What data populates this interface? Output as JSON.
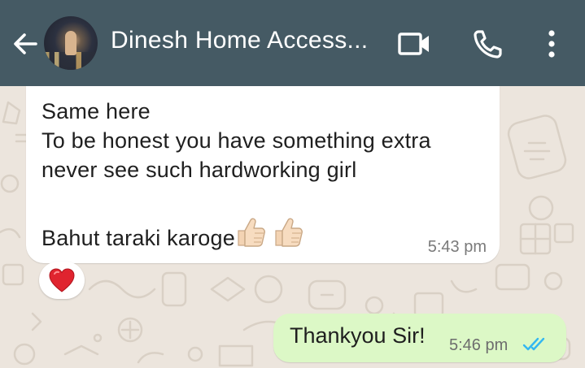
{
  "header": {
    "contact_name": "Dinesh Home Access...",
    "background_color": "#455a64",
    "icons": [
      "back-arrow-icon",
      "video-call-icon",
      "phone-icon",
      "more-vert-icon"
    ]
  },
  "messages": [
    {
      "direction": "incoming",
      "lines": [
        "Same here",
        "To be honest you have something extra",
        "never see such hardworking girl",
        "",
        "Bahut taraki karoge"
      ],
      "emoji": [
        "thumbs-up",
        "thumbs-up"
      ],
      "time": "5:43 pm",
      "reaction": "red-heart"
    },
    {
      "direction": "outgoing",
      "text": "Thankyou Sir!",
      "time": "5:46 pm",
      "status": "read",
      "tick_color": "#34b7f1"
    }
  ],
  "colors": {
    "chat_background": "#ece5dd",
    "incoming_bubble": "#ffffff",
    "outgoing_bubble": "#dcf8c6"
  }
}
